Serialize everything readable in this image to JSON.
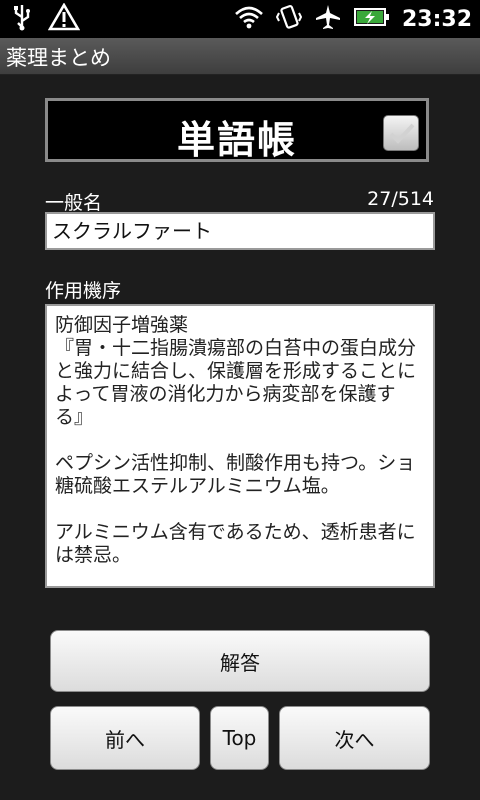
{
  "status_bar": {
    "time": "23:32",
    "icons": [
      "usb-icon",
      "warning-icon",
      "wifi-icon",
      "vibrate-icon",
      "airplane-icon",
      "battery-charging-icon"
    ]
  },
  "app": {
    "title": "薬理まとめ"
  },
  "card": {
    "header": "単語帳",
    "checkbox_checked": false,
    "name_label": "一般名",
    "counter": "27/514",
    "name_value": "スクラルファート",
    "mechanism_label": "作用機序",
    "mechanism_text": "防御因子増強薬\n『胃・十二指腸潰瘍部の白苔中の蛋白成分と強力に結合し、保護層を形成することによって胃液の消化力から病変部を保護する』\n\nペプシン活性抑制、制酸作用も持つ。ショ糖硫酸エステルアルミニウム塩。\n\nアルミニウム含有であるため、透析患者には禁忌。"
  },
  "buttons": {
    "answer": "解答",
    "prev": "前へ",
    "top": "Top",
    "next": "次へ"
  }
}
